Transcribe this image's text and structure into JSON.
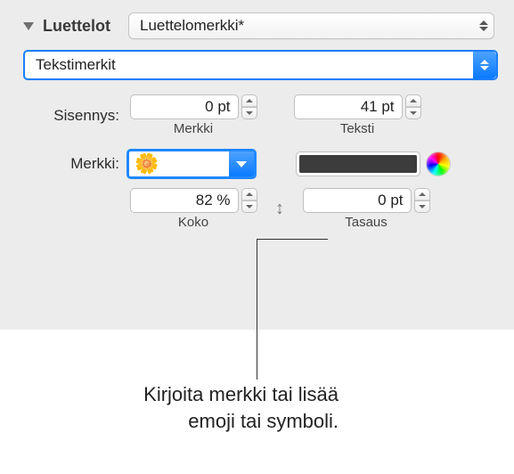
{
  "header": {
    "title": "Luettelot"
  },
  "style_popup": {
    "value": "Luettelomerkki*"
  },
  "type_popup": {
    "value": "Tekstimerkit"
  },
  "indent": {
    "label": "Sisennys:",
    "bullet_value": "0 pt",
    "bullet_sub": "Merkki",
    "text_value": "41 pt",
    "text_sub": "Teksti"
  },
  "bullet": {
    "label": "Merkki:",
    "emoji": "🌼",
    "color": "#3c3c3c"
  },
  "size": {
    "value": "82 %",
    "sub": "Koko"
  },
  "align": {
    "value": "0 pt",
    "sub": "Tasaus"
  },
  "caption": {
    "line1": "Kirjoita merkki tai lisää",
    "line2": "emoji tai symboli."
  }
}
